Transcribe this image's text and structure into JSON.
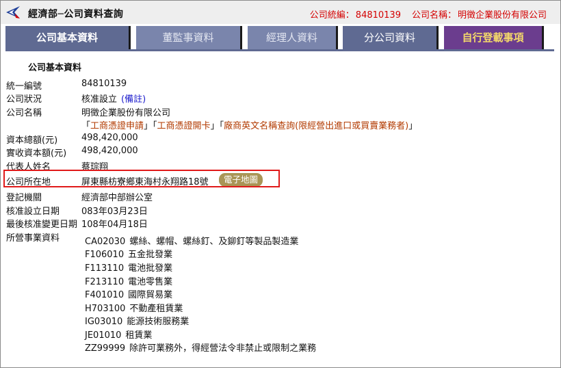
{
  "header": {
    "title": "經濟部─公司資料查詢",
    "ban_label": "公司統編：",
    "ban_value": "84810139",
    "name_label": "公司名稱：",
    "name_value": "明徵企業股份有限公司",
    "logo_icon": "moea-logo-icon",
    "colors": {
      "accent": "#d40000",
      "header_bg": "#eeeeee"
    }
  },
  "tabs": [
    {
      "label": "公司基本資料"
    },
    {
      "label": "董監事資料"
    },
    {
      "label": "經理人資料"
    },
    {
      "label": "分公司資料"
    },
    {
      "label": "自行登載事項"
    }
  ],
  "section_title": "公司基本資料",
  "fields": {
    "ban": {
      "label": "統一編號",
      "value": "84810139"
    },
    "status": {
      "label": "公司狀況",
      "value": "核准設立",
      "note_link": "(備註)"
    },
    "name": {
      "label": "公司名稱",
      "value": "明徵企業股份有限公司"
    },
    "links": [
      {
        "text": "工商憑證申請"
      },
      {
        "text": "工商憑證開卡"
      },
      {
        "text": "廠商英文名稱查詢(限經營出進口或買賣業務者)"
      }
    ],
    "capital_total": {
      "label": "資本總額(元)",
      "value": "498,420,000"
    },
    "capital_paid": {
      "label": "實收資本額(元)",
      "value": "498,420,000"
    },
    "representative": {
      "label": "代表人姓名",
      "value": "蔡琮翔"
    },
    "address": {
      "label": "公司所在地",
      "value": "屏東縣枋寮鄉東海村永翔路18號",
      "map_button": "電子地圖"
    },
    "authority": {
      "label": "登記機關",
      "value": "經濟部中部辦公室"
    },
    "approval_date": {
      "label": "核准設立日期",
      "value": "083年03月23日"
    },
    "last_change_date": {
      "label": "最後核准變更日期",
      "value": "108年04月18日"
    },
    "business_label": "所營事業資料"
  },
  "business_items": [
    {
      "code": "CA02030",
      "desc": "螺絲、螺帽、螺絲釘、及鉚釘等製品製造業"
    },
    {
      "code": "F106010",
      "desc": "五金批發業"
    },
    {
      "code": "F113110",
      "desc": "電池批發業"
    },
    {
      "code": "F213110",
      "desc": "電池零售業"
    },
    {
      "code": "F401010",
      "desc": "國際貿易業"
    },
    {
      "code": "H703100",
      "desc": "不動產租賃業"
    },
    {
      "code": "IG03010",
      "desc": "能源技術服務業"
    },
    {
      "code": "JE01010",
      "desc": "租賃業"
    },
    {
      "code": "ZZ99999",
      "desc": "除許可業務外，得經營法令非禁止或限制之業務"
    }
  ]
}
